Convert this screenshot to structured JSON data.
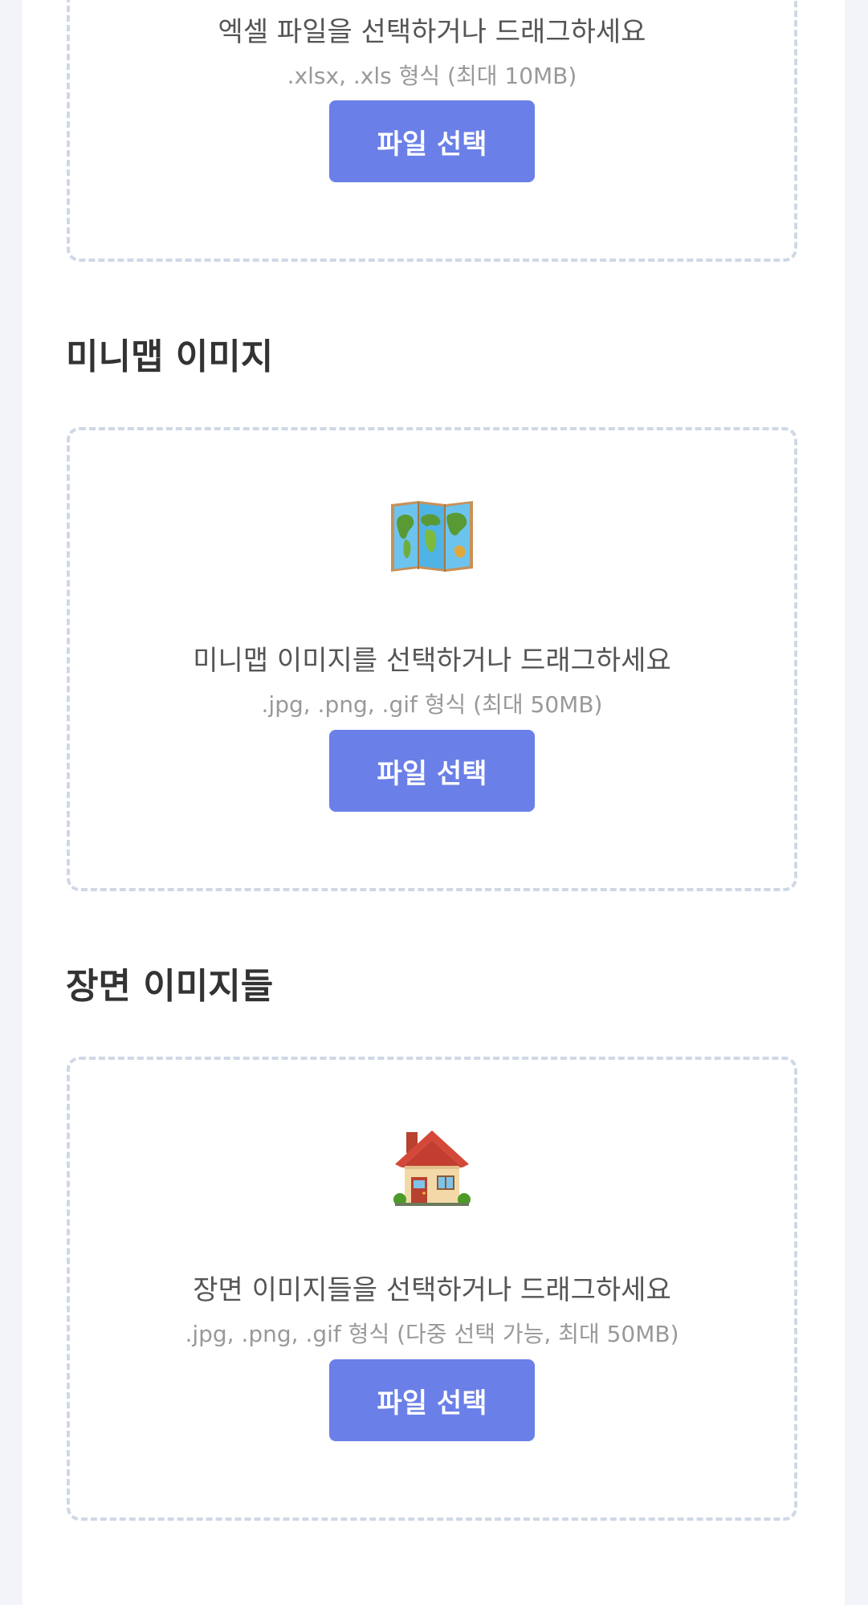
{
  "excel_upload": {
    "prompt": "엑셀 파일을 선택하거나 드래그하세요",
    "hint": ".xlsx, .xls 형식 (최대 10MB)",
    "button_label": "파일 선택"
  },
  "minimap_section": {
    "title": "미니맵 이미지",
    "icon": "world-map-icon",
    "prompt": "미니맵 이미지를 선택하거나 드래그하세요",
    "hint": ".jpg, .png, .gif 형식 (최대 50MB)",
    "button_label": "파일 선택"
  },
  "scene_section": {
    "title": "장면 이미지들",
    "icon": "house-icon",
    "prompt": "장면 이미지들을 선택하거나 드래그하세요",
    "hint": ".jpg, .png, .gif 형식 (다중 선택 가능, 최대 50MB)",
    "button_label": "파일 선택"
  },
  "colors": {
    "accent": "#6a7fe7",
    "page_background": "#f3f4f9",
    "card_background": "#ffffff",
    "dropzone_border": "#cfd8e6",
    "heading_text": "#333333",
    "body_text": "#555555",
    "hint_text": "#999999"
  }
}
